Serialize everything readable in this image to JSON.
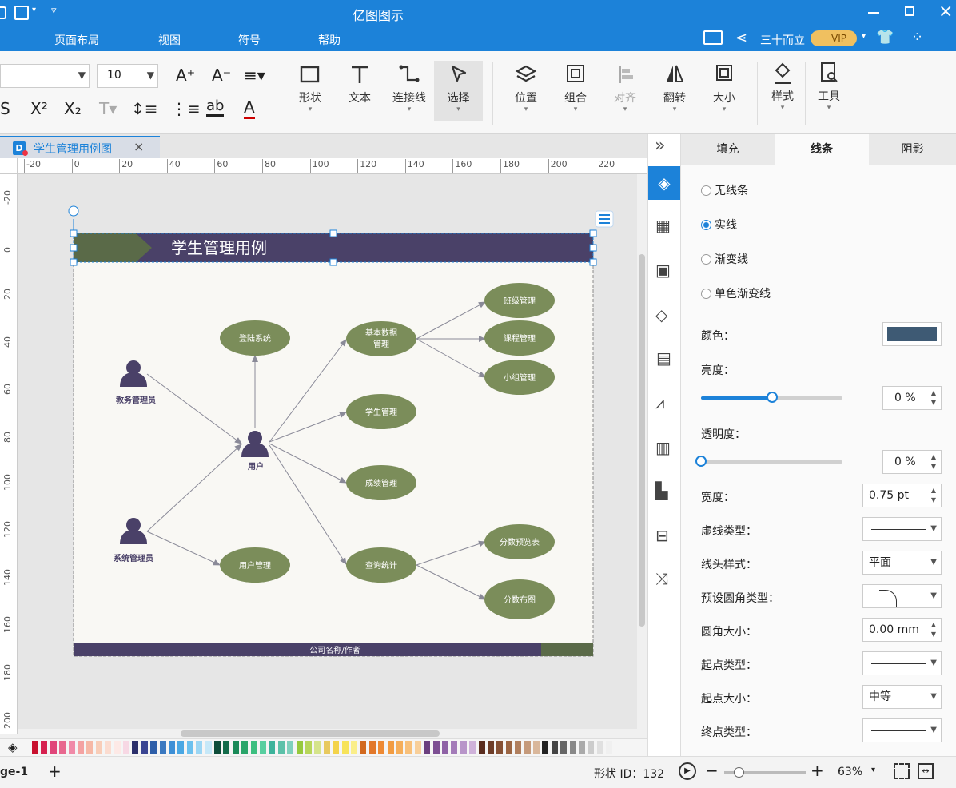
{
  "app": {
    "title": "亿图图示"
  },
  "menu": {
    "items": [
      "页面布局",
      "视图",
      "符号",
      "帮助"
    ]
  },
  "account": {
    "user_name": "三十而立",
    "vip_badge": "VIP"
  },
  "ribbon": {
    "font_size": "10",
    "buttons": {
      "shape": "形状",
      "text": "文本",
      "connector": "连接线",
      "select": "选择",
      "position": "位置",
      "group": "组合",
      "align": "对齐",
      "flip": "翻转",
      "size": "大小",
      "style": "样式",
      "tools": "工具"
    }
  },
  "document": {
    "tab_title": "学生管理用例图"
  },
  "ruler": {
    "h_ticks": [
      "-20",
      "0",
      "20",
      "40",
      "60",
      "80",
      "100",
      "120",
      "140",
      "160",
      "180",
      "200",
      "220"
    ],
    "v_ticks": [
      "-20",
      "0",
      "20",
      "40",
      "60",
      "80",
      "100",
      "120",
      "140",
      "160",
      "180",
      "200"
    ]
  },
  "diagram": {
    "header_title": "学生管理用例",
    "footer_text": "公司名称/作者",
    "actors": {
      "admin_affairs": "教务管理员",
      "user": "用户",
      "admin_system": "系统管理员"
    },
    "use_cases": {
      "login": "登陆系统",
      "basic_data_1": "基本数据",
      "basic_data_2": "管理",
      "class_mgmt": "班级管理",
      "course_mgmt": "课程管理",
      "group_mgmt": "小组管理",
      "student_mgmt": "学生管理",
      "grade_mgmt": "成绩管理",
      "user_mgmt": "用户管理",
      "query_stats": "查询统计",
      "score_preview": "分数预览表",
      "score_dist": "分数布图"
    }
  },
  "properties": {
    "tabs": [
      "填充",
      "线条",
      "阴影"
    ],
    "line_options": [
      "无线条",
      "实线",
      "渐变线",
      "单色渐变线"
    ],
    "labels": {
      "color": "颜色：",
      "brightness": "亮度：",
      "transparency": "透明度：",
      "width": "宽度：",
      "dash_type": "虚线类型：",
      "cap_style": "线头样式：",
      "corner_type": "预设圆角类型：",
      "corner_size": "圆角大小：",
      "start_type": "起点类型：",
      "start_size": "起点大小：",
      "end_type": "终点类型："
    },
    "values": {
      "brightness": "0 %",
      "transparency": "0 %",
      "width": "0.75 pt",
      "cap_style": "平面",
      "corner_size": "0.00 mm",
      "start_size": "中等"
    },
    "line_color": "#3e5a74",
    "brightness_level": 0.5,
    "transparency_level": 0
  },
  "status": {
    "page_label": "ge-1",
    "shape_id": "形状 ID：132",
    "zoom": "63%"
  },
  "colors": {
    "accent": "#1c82d9",
    "header_purple": "#4a4168",
    "header_green": "#5a6a48",
    "ellipse_green": "#7b8d5a",
    "actor_purple": "#4a4168",
    "canvas_bg": "#f9f8f4"
  }
}
